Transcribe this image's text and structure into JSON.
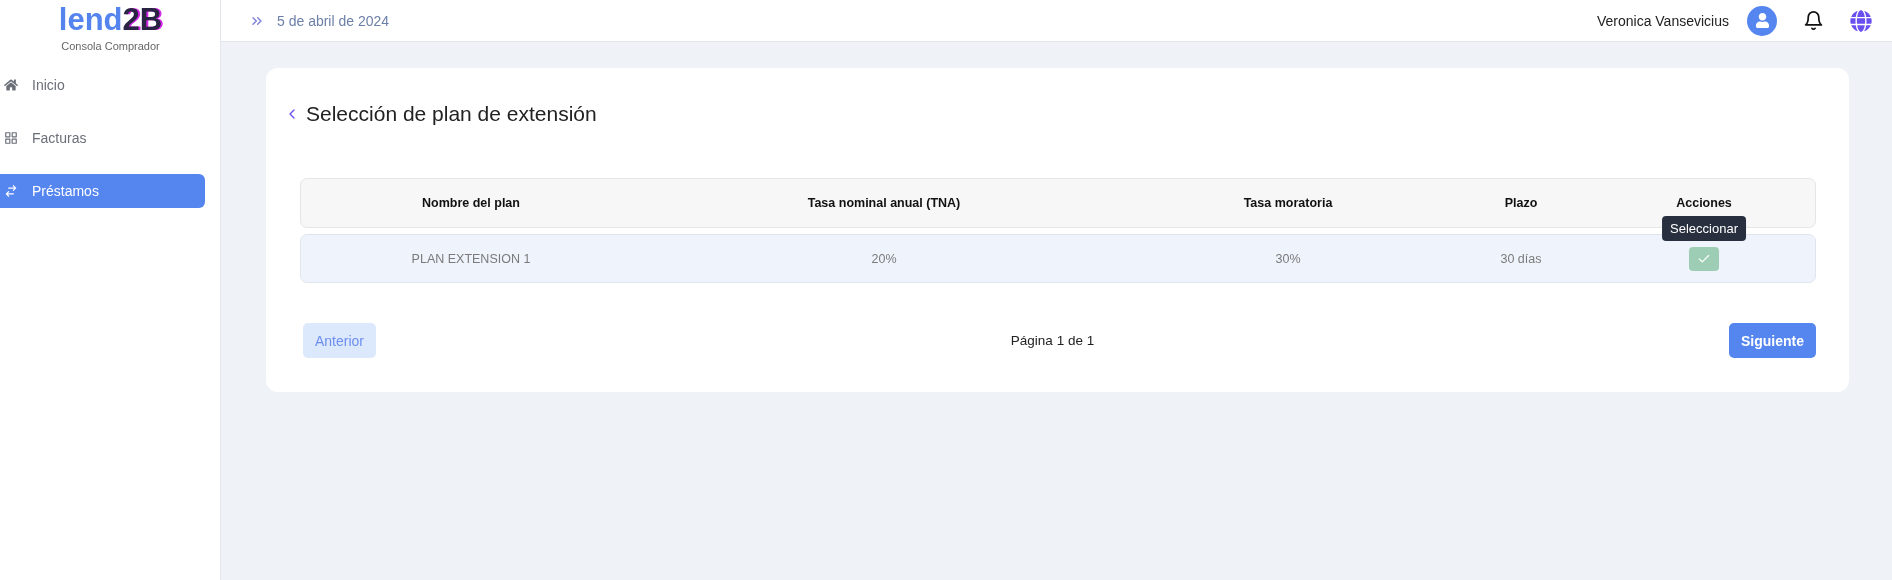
{
  "logo": {
    "primary": "lend",
    "secondary": "2B",
    "subtitle": "Consola Comprador"
  },
  "sidebar": {
    "items": [
      {
        "label": "Inicio",
        "selected": false
      },
      {
        "label": "Facturas",
        "selected": false
      },
      {
        "label": "Préstamos",
        "selected": true
      }
    ]
  },
  "header": {
    "date": "5 de abril de 2024",
    "user": "Veronica Vansevicius"
  },
  "page": {
    "title": "Selección de plan de extensión"
  },
  "table": {
    "columns": [
      "Nombre del plan",
      "Tasa nominal anual (TNA)",
      "Tasa moratoria",
      "Plazo",
      "Acciones"
    ],
    "rows": [
      {
        "cells": [
          "PLAN EXTENSION 1",
          "20%",
          "30%",
          "30 días"
        ],
        "tooltip": "Seleccionar"
      }
    ]
  },
  "pagination": {
    "previous": "Anterior",
    "info": "Página 1 de 1",
    "next": "Siguiente",
    "previous_disabled": true
  }
}
